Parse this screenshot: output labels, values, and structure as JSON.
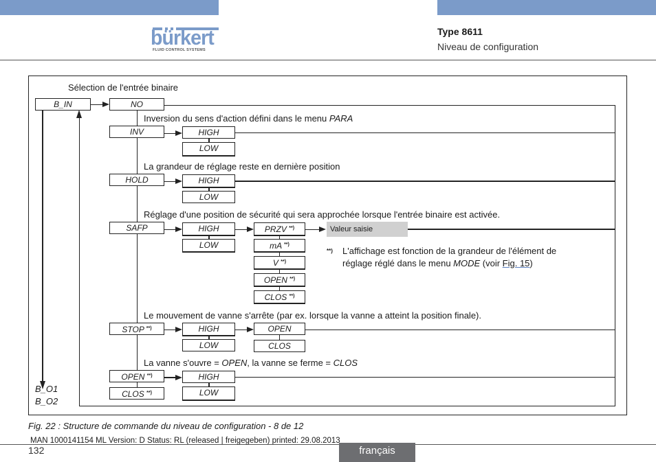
{
  "header": {
    "logo_text": "bürkert",
    "logo_tagline": "FLUID CONTROL SYSTEMS",
    "type_label": "Type 8611",
    "section_title": "Niveau de configuration",
    "brand_color": "#7b9bc9"
  },
  "diagram": {
    "root": {
      "label": "B_IN",
      "title": "Sélection de l'entrée binaire",
      "outputs": [
        "B_O1",
        "B_O2"
      ]
    },
    "options": [
      {
        "label": "NO"
      },
      {
        "label": "INV",
        "description": "Inversion du sens d'action défini dans le menu ",
        "description_em": "PARA",
        "levels": [
          "HIGH",
          "LOW"
        ]
      },
      {
        "label": "HOLD",
        "description": "La grandeur de réglage reste en dernière position",
        "levels": [
          "HIGH",
          "LOW"
        ]
      },
      {
        "label": "SAFP",
        "description": "Réglage d'une position de sécurité qui sera approchée lorsque l'entrée binaire est activée.",
        "levels": [
          "HIGH",
          "LOW"
        ],
        "submodes": [
          "PRZV",
          "mA",
          "V",
          "OPEN",
          "CLOS"
        ],
        "value_box": "Valeur saisie"
      },
      {
        "label": "STOP",
        "description": "Le mouvement de vanne s'arrête (par ex. lorsque la vanne a atteint la position finale).",
        "levels": [
          "HIGH",
          "LOW"
        ],
        "positions": [
          "OPEN",
          "CLOS"
        ]
      },
      {
        "label_open": "OPEN",
        "label_clos": "CLOS",
        "description_parts": [
          "La vanne s'ouvre = ",
          "OPEN",
          ", la vanne se ferme = ",
          "CLOS"
        ],
        "levels": [
          "HIGH",
          "LOW"
        ]
      }
    ],
    "footnote_marker": "**)",
    "footnote_text_1": "L'affichage est fonction de la grandeur de l'élément de",
    "footnote_text_2a": "réglage réglé dans le menu ",
    "footnote_text_2_em": "MODE",
    "footnote_text_2b": " (voir ",
    "footnote_link": "Fig. 15",
    "footnote_text_2c": ")",
    "footnote_sup": "**)"
  },
  "caption": "Fig. 22 :  Structure de commande du niveau de configuration - 8 de 12",
  "footer": {
    "meta": "MAN  1000141154  ML  Version: D Status: RL (released | freigegeben)  printed: 29.08.2013",
    "page_number": "132",
    "language": "français"
  }
}
